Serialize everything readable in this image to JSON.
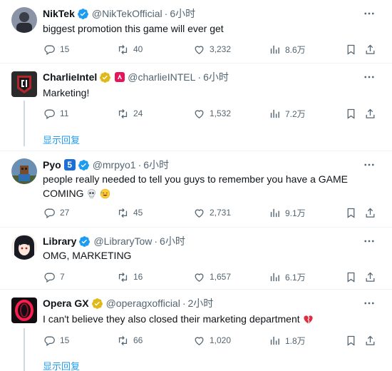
{
  "tweets": [
    {
      "name": "NikTek",
      "handle": "@NikTekOfficial",
      "time": "6小时",
      "text": "biggest promotion this game will ever get",
      "replies": "15",
      "retweets": "40",
      "likes": "3,232",
      "views": "8.6万"
    },
    {
      "name": "CharlieIntel",
      "handle": "@charlieINTEL",
      "time": "6小时",
      "text": "Marketing!",
      "replies": "11",
      "retweets": "24",
      "likes": "1,532",
      "views": "7.2万",
      "show_replies": "显示回复"
    },
    {
      "name": "Pyo",
      "badge": "5",
      "handle": "@mrpyo1",
      "time": "6小时",
      "text": "people really needed to tell you guys to remember you have a GAME COMING",
      "replies": "27",
      "retweets": "45",
      "likes": "2,731",
      "views": "9.1万"
    },
    {
      "name": "Library",
      "handle": "@LibraryTow",
      "time": "6小时",
      "text": "OMG, MARKETING",
      "replies": "7",
      "retweets": "16",
      "likes": "1,657",
      "views": "6.1万"
    },
    {
      "name": "Opera GX",
      "handle": "@operagxofficial",
      "time": "2小时",
      "text": "I can't believe they also closed their marketing department",
      "replies": "15",
      "retweets": "66",
      "likes": "1,020",
      "views": "1.8万",
      "show_replies": "显示回复"
    }
  ],
  "separator": "·",
  "colors": {
    "blue_check": "#1d9bf0",
    "gold_check": "#e2b719",
    "muted": "#536471",
    "link": "#1d9bf0"
  },
  "icons": [
    "more-icon",
    "reply-icon",
    "retweet-icon",
    "like-icon",
    "views-icon",
    "bookmark-icon",
    "share-icon"
  ]
}
